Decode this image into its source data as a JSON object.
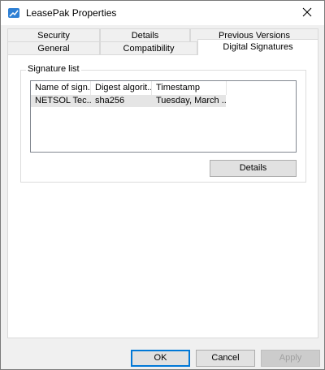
{
  "window": {
    "title": "LeasePak Properties",
    "close_glyph": "✕"
  },
  "tabs": {
    "row1": [
      "Security",
      "Details",
      "Previous Versions"
    ],
    "row2": [
      "General",
      "Compatibility",
      "Digital Signatures"
    ],
    "active": "Digital Signatures"
  },
  "signature_list": {
    "group_label": "Signature list",
    "columns": [
      "Name of sign...",
      "Digest algorit...",
      "Timestamp"
    ],
    "rows": [
      [
        "NETSOL Tec...",
        "sha256",
        "Tuesday, March ..."
      ]
    ],
    "details_button": "Details"
  },
  "footer": {
    "ok": "OK",
    "cancel": "Cancel",
    "apply": "Apply"
  },
  "colors": {
    "accent": "#0078d7",
    "icon_blue": "#2d7fd4",
    "selected_row": "#e5e5e5"
  },
  "icons": {
    "app": "properties-document-icon",
    "close": "close-icon"
  }
}
